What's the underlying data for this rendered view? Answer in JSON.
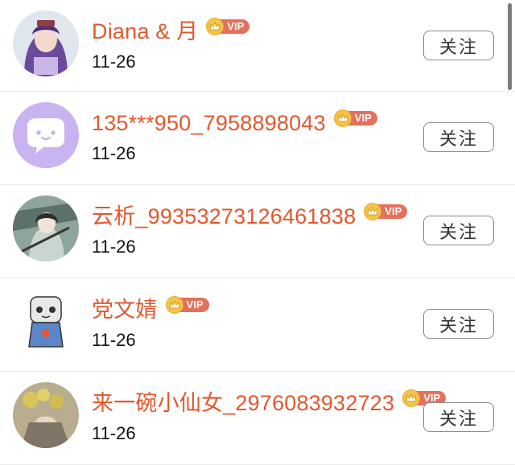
{
  "follow_label": "关注",
  "vip_label": "VIP",
  "users": [
    {
      "name": "Diana & 月",
      "date": "11-26"
    },
    {
      "name": "135***950_7958898043",
      "date": "11-26"
    },
    {
      "name": "云析_99353273126461838",
      "date": "11-26"
    },
    {
      "name": "党文婧",
      "date": "11-26"
    },
    {
      "name": "来一碗小仙女_2976083932723",
      "date": "11-26"
    }
  ],
  "colors": {
    "name": "#e4572e",
    "vip_badge": "#e5705c",
    "crown": "#f3c34b"
  }
}
